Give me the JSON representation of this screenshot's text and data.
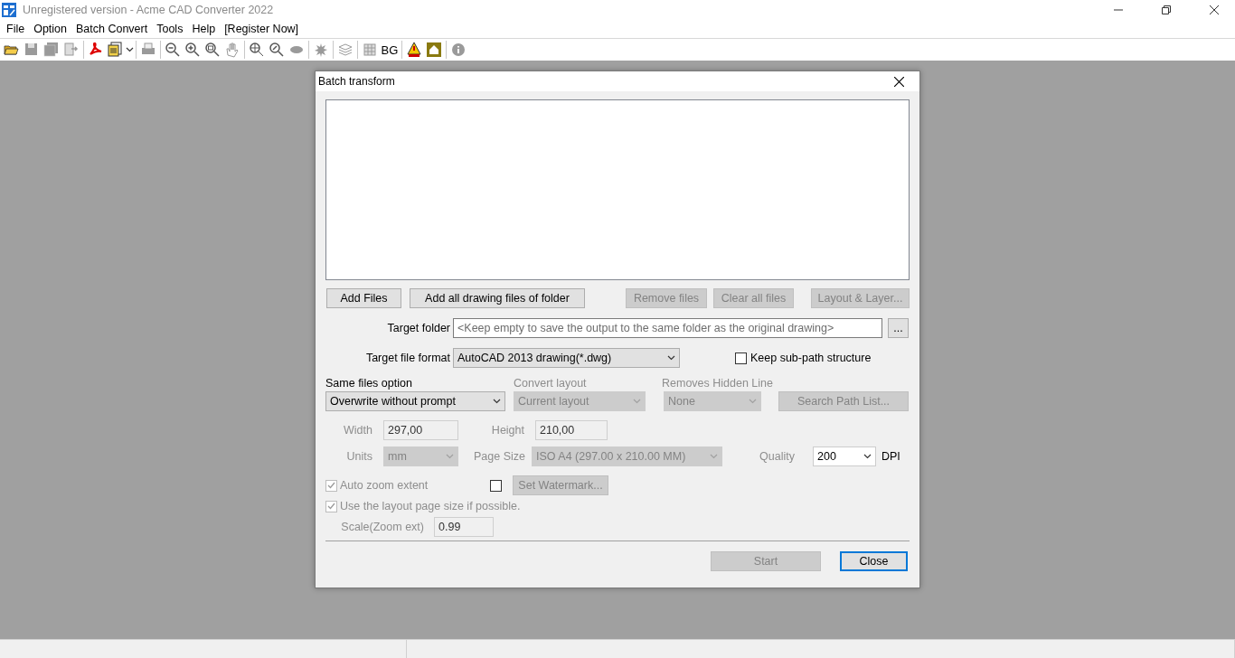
{
  "window": {
    "title": "Unregistered version - Acme CAD Converter 2022"
  },
  "menu": [
    {
      "label": "File"
    },
    {
      "label": "Option"
    },
    {
      "label": "Batch Convert"
    },
    {
      "label": "Tools"
    },
    {
      "label": "Help"
    },
    {
      "label": "[Register Now]"
    }
  ],
  "toolbar": [
    {
      "kind": "icon",
      "disabled": false
    },
    {
      "kind": "icon",
      "disabled": true
    },
    {
      "kind": "icon",
      "disabled": true
    },
    {
      "kind": "icon",
      "disabled": true
    },
    {
      "kind": "separator"
    },
    {
      "kind": "icon",
      "disabled": false
    },
    {
      "kind": "icon",
      "disabled": false
    },
    {
      "kind": "separator"
    },
    {
      "kind": "icon",
      "disabled": true
    },
    {
      "kind": "separator"
    },
    {
      "kind": "icon",
      "disabled": false
    },
    {
      "kind": "icon",
      "disabled": false
    },
    {
      "kind": "icon",
      "disabled": false
    },
    {
      "kind": "icon",
      "disabled": true
    },
    {
      "kind": "separator"
    },
    {
      "kind": "icon",
      "disabled": false
    },
    {
      "kind": "icon",
      "disabled": false
    },
    {
      "kind": "icon",
      "disabled": true
    },
    {
      "kind": "separator"
    },
    {
      "kind": "icon",
      "disabled": true
    },
    {
      "kind": "separator"
    },
    {
      "kind": "icon",
      "disabled": true
    },
    {
      "kind": "separator"
    },
    {
      "kind": "icon",
      "disabled": true
    },
    {
      "kind": "text",
      "label": "BG"
    },
    {
      "kind": "separator"
    },
    {
      "kind": "icon",
      "disabled": false
    },
    {
      "kind": "icon",
      "disabled": false
    },
    {
      "kind": "separator"
    },
    {
      "kind": "icon",
      "disabled": true
    }
  ],
  "dialog": {
    "title": "Batch transform",
    "file_buttons": [
      {
        "label": "Add Files",
        "disabled": false
      },
      {
        "label": "Add all drawing files of folder",
        "disabled": false
      },
      {
        "label": "Remove files",
        "disabled": true
      },
      {
        "label": "Clear all files",
        "disabled": true
      },
      {
        "label": "Layout & Layer...",
        "disabled": true
      }
    ],
    "target_folder": {
      "label": "Target folder",
      "placeholder": "<Keep empty to save the output to the same folder as the original drawing>",
      "browse": "..."
    },
    "target_format": {
      "label": "Target file format",
      "value": "AutoCAD 2013 drawing(*.dwg)",
      "disabled": false
    },
    "keep_subpath": {
      "label": "Keep sub-path structure",
      "checked": false,
      "disabled": false
    },
    "same_files": {
      "label": "Same files option",
      "value": "Overwrite without prompt",
      "disabled": false
    },
    "convert_layout": {
      "label": "Convert layout",
      "value": "Current layout",
      "disabled": true
    },
    "hidden_line": {
      "label": "Removes Hidden Line",
      "value": "None",
      "disabled": true
    },
    "search_path": {
      "label": "Search Path List...",
      "disabled": true
    },
    "width": {
      "label": "Width",
      "value": "297,00",
      "disabled": true
    },
    "height": {
      "label": "Height",
      "value": "210,00",
      "disabled": true
    },
    "units": {
      "label": "Units",
      "value": "mm",
      "disabled": true
    },
    "page_size": {
      "label": "Page Size",
      "value": "ISO A4 (297.00 x 210.00 MM)",
      "disabled": true
    },
    "quality": {
      "label": "Quality",
      "value": "200",
      "unit": "DPI",
      "disabled": true
    },
    "auto_zoom": {
      "label": "Auto zoom extent",
      "checked": true,
      "disabled": true
    },
    "watermark": {
      "checked": false,
      "button": "Set Watermark...",
      "disabled": true
    },
    "layout_page_size": {
      "label": "Use the layout page size if possible.",
      "checked": true,
      "disabled": true
    },
    "scale": {
      "label": "Scale(Zoom ext)",
      "value": "0.99",
      "disabled": true
    },
    "actions": [
      {
        "label": "Start",
        "disabled": true,
        "default": false
      },
      {
        "label": "Close",
        "disabled": false,
        "default": true
      }
    ]
  }
}
